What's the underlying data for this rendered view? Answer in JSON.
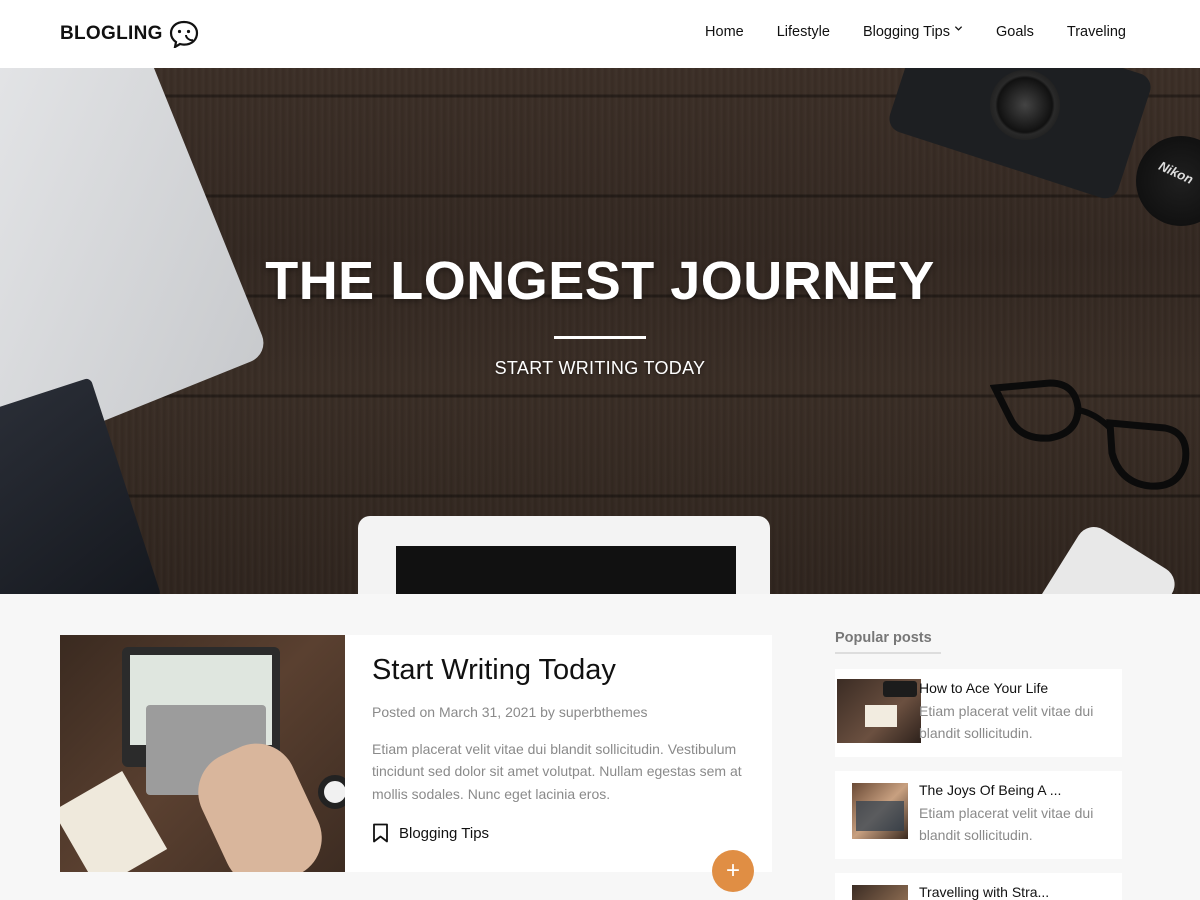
{
  "site": {
    "logo_text": "BLOGLING",
    "logo_icon": "speech-bubble-face-icon"
  },
  "nav": {
    "items": [
      {
        "label": "Home"
      },
      {
        "label": "Lifestyle"
      },
      {
        "label": "Blogging Tips",
        "has_dropdown": true
      },
      {
        "label": "Goals"
      },
      {
        "label": "Traveling"
      }
    ]
  },
  "hero": {
    "title": "THE LONGEST JOURNEY",
    "subtitle": "START WRITING TODAY",
    "lens_cap_text": "Nikon"
  },
  "post": {
    "title": "Start Writing Today",
    "meta_prefix": "Posted on",
    "date": "March 31, 2021",
    "meta_by": "by",
    "author": "superbthemes",
    "excerpt": "Etiam placerat velit vitae dui blandit sollicitudin. Vestibulum tincidunt sed dolor sit amet volutpat. Nullam egestas sem at mollis sodales. Nunc eget lacinia eros.",
    "category": "Blogging Tips",
    "category_icon": "bookmark-icon",
    "fab_label": "+"
  },
  "sidebar": {
    "title": "Popular posts",
    "items": [
      {
        "title": "How to Ace Your Life",
        "excerpt": "Etiam placerat velit vitae dui blandit sollicitudin."
      },
      {
        "title": "The Joys Of Being A ...",
        "excerpt": "Etiam placerat velit vitae dui blandit sollicitudin."
      },
      {
        "title": "Travelling with Stra...",
        "excerpt": ""
      }
    ]
  },
  "colors": {
    "accent": "#e08e44",
    "muted_text": "#8a8a8a",
    "background": "#f7f7f7"
  }
}
